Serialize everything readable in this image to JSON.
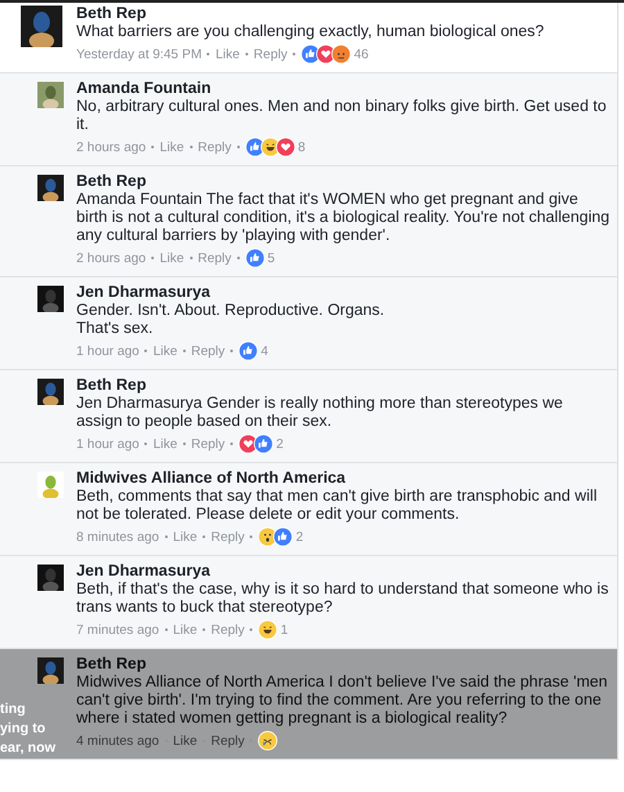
{
  "comments": [
    {
      "author": "Beth Rep",
      "text": "What barriers are you challenging exactly, human biological ones?",
      "time": "Yesterday at 9:45 PM",
      "like": "Like",
      "reply": "Reply",
      "reactions": [
        {
          "kind": "like"
        },
        {
          "kind": "love"
        },
        {
          "kind": "angry"
        }
      ],
      "count": "46",
      "reply_level": false,
      "dimmed": false
    },
    {
      "author": "Amanda Fountain",
      "text": "No, arbitrary cultural ones. Men and non binary folks give birth. Get used to it.",
      "time": "2 hours ago",
      "like": "Like",
      "reply": "Reply",
      "reactions": [
        {
          "kind": "like"
        },
        {
          "kind": "haha"
        },
        {
          "kind": "love"
        }
      ],
      "count": "8",
      "reply_level": true,
      "dimmed": false
    },
    {
      "author": "Beth Rep",
      "text": "Amanda Fountain The fact that it's WOMEN who get pregnant and give birth is not a cultural condition, it's a biological reality. You're not challenging any cultural barriers by 'playing with gender'.",
      "time": "2 hours ago",
      "like": "Like",
      "reply": "Reply",
      "reactions": [
        {
          "kind": "like"
        }
      ],
      "count": "5",
      "reply_level": true,
      "dimmed": false
    },
    {
      "author": "Jen Dharmasurya",
      "text": "Gender. Isn't. About. Reproductive. Organs.\nThat's sex.",
      "time": "1 hour ago",
      "like": "Like",
      "reply": "Reply",
      "reactions": [
        {
          "kind": "like"
        }
      ],
      "count": "4",
      "reply_level": true,
      "dimmed": false
    },
    {
      "author": "Beth Rep",
      "text": "Jen Dharmasurya Gender is really nothing more than stereotypes we assign to people based on their sex.",
      "time": "1 hour ago",
      "like": "Like",
      "reply": "Reply",
      "reactions": [
        {
          "kind": "love"
        },
        {
          "kind": "like"
        }
      ],
      "count": "2",
      "reply_level": true,
      "dimmed": false
    },
    {
      "author": "Midwives Alliance of North America",
      "text": "Beth, comments that say that men can't give birth are transphobic and will not be tolerated. Please delete or edit your comments.",
      "time": "8 minutes ago",
      "like": "Like",
      "reply": "Reply",
      "reactions": [
        {
          "kind": "wow"
        },
        {
          "kind": "like"
        }
      ],
      "count": "2",
      "reply_level": true,
      "dimmed": false
    },
    {
      "author": "Jen Dharmasurya",
      "text": "Beth, if that's the case, why is it so hard to understand that someone who is trans wants to buck that stereotype?",
      "time": "7 minutes ago",
      "like": "Like",
      "reply": "Reply",
      "reactions": [
        {
          "kind": "haha"
        }
      ],
      "count": "1",
      "reply_level": true,
      "dimmed": false
    },
    {
      "author": "Beth Rep",
      "text": "Midwives Alliance of North America I don't believe I've said the phrase 'men can't give birth'. I'm trying to find the comment. Are you referring to the one where i stated women getting pregnant is a biological reality?",
      "time": "4 minutes ago",
      "like": "Like",
      "reply": "Reply",
      "reactions": [
        {
          "kind": "sad"
        }
      ],
      "reply_level": true,
      "dimmed": true
    }
  ],
  "overlay_lines": [
    "ting",
    "ying to",
    "ear, now"
  ]
}
